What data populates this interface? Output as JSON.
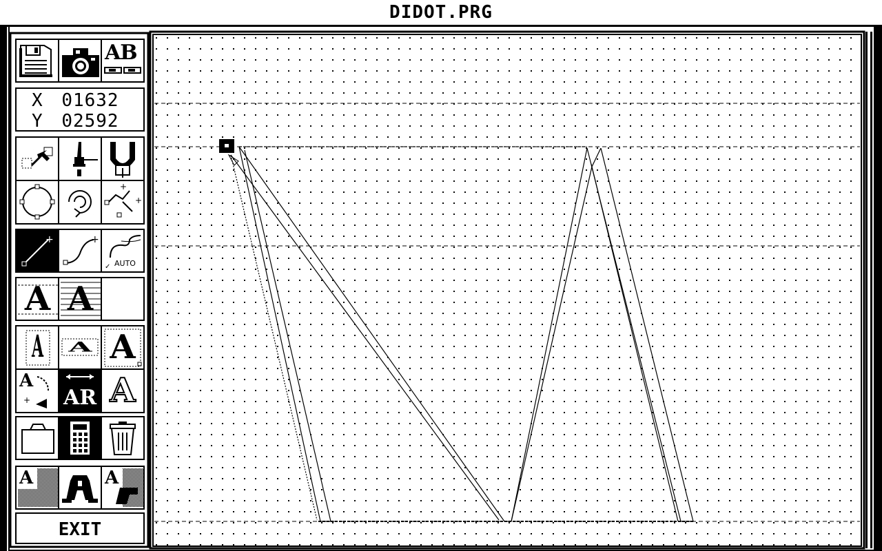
{
  "window": {
    "title": "DIDOT.PRG"
  },
  "coordinates": {
    "x_label": "X",
    "x_value": "01632",
    "y_label": "Y",
    "y_value": "02592"
  },
  "toolbar": {
    "top_icons": [
      "floppy-disk-icon",
      "camera-icon",
      "ab-text-icon"
    ],
    "ab_text": "AB",
    "auto_label": "AUTO",
    "letter": "A",
    "exit_label": "EXIT",
    "active_tools": [
      "draw-line-tool",
      "text-flip-tool",
      "calculator-icon"
    ]
  },
  "canvas": {
    "grid": true,
    "guide_lines": 4,
    "glyph": "M"
  }
}
